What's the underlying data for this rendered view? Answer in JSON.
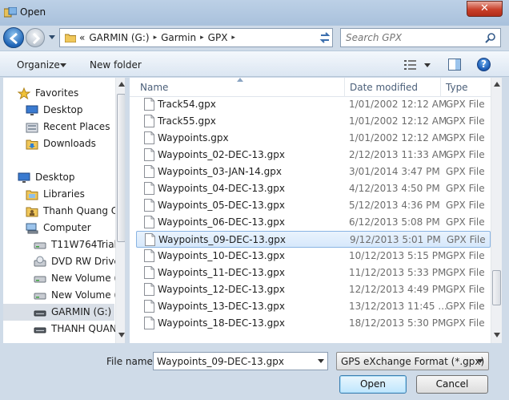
{
  "window": {
    "title": "Open",
    "close_glyph": "✕"
  },
  "address": {
    "prefix": "«",
    "crumbs": [
      "GARMIN (G:)",
      "Garmin",
      "GPX"
    ],
    "separator": "▸"
  },
  "search": {
    "placeholder": "Search GPX"
  },
  "toolbar": {
    "organize": "Organize",
    "new_folder": "New folder",
    "help_glyph": "?"
  },
  "nav": {
    "items": [
      {
        "label": "Favorites",
        "icon": "star-icon",
        "indent": 1
      },
      {
        "label": "Desktop",
        "icon": "desktop-icon",
        "indent": 2
      },
      {
        "label": "Recent Places",
        "icon": "recent-places-icon",
        "indent": 2
      },
      {
        "label": "Downloads",
        "icon": "downloads-icon",
        "indent": 2
      },
      {
        "label": "Desktop",
        "icon": "desktop-icon",
        "indent": 1
      },
      {
        "label": "Libraries",
        "icon": "libraries-icon",
        "indent": 2
      },
      {
        "label": "Thanh Quang C",
        "icon": "user-folder-icon",
        "indent": 2
      },
      {
        "label": "Computer",
        "icon": "computer-icon",
        "indent": 2
      },
      {
        "label": "T11W764Trial",
        "icon": "drive-icon",
        "indent": 3
      },
      {
        "label": "DVD RW Drive",
        "icon": "dvd-drive-icon",
        "indent": 3
      },
      {
        "label": "New Volume (",
        "icon": "drive-icon",
        "indent": 3
      },
      {
        "label": "New Volume (",
        "icon": "drive-icon",
        "indent": 3
      },
      {
        "label": "GARMIN (G:)",
        "icon": "removable-drive-icon",
        "indent": 3,
        "selected": true
      },
      {
        "label": "THANH QUAN",
        "icon": "removable-drive-icon",
        "indent": 3
      }
    ]
  },
  "columns": {
    "name": "Name",
    "date": "Date modified",
    "type": "Type"
  },
  "files": [
    {
      "name": "Track54.gpx",
      "date": "1/01/2002 12:12 AM",
      "type": "GPX File"
    },
    {
      "name": "Track55.gpx",
      "date": "1/01/2002 12:12 AM",
      "type": "GPX File"
    },
    {
      "name": "Waypoints.gpx",
      "date": "1/01/2002 12:12 AM",
      "type": "GPX File"
    },
    {
      "name": "Waypoints_02-DEC-13.gpx",
      "date": "2/12/2013 11:33 AM",
      "type": "GPX File"
    },
    {
      "name": "Waypoints_03-JAN-14.gpx",
      "date": "3/01/2014 3:47 PM",
      "type": "GPX File"
    },
    {
      "name": "Waypoints_04-DEC-13.gpx",
      "date": "4/12/2013 4:50 PM",
      "type": "GPX File"
    },
    {
      "name": "Waypoints_05-DEC-13.gpx",
      "date": "5/12/2013 4:36 PM",
      "type": "GPX File"
    },
    {
      "name": "Waypoints_06-DEC-13.gpx",
      "date": "6/12/2013 5:08 PM",
      "type": "GPX File"
    },
    {
      "name": "Waypoints_09-DEC-13.gpx",
      "date": "9/12/2013 5:01 PM",
      "type": "GPX File",
      "selected": true
    },
    {
      "name": "Waypoints_10-DEC-13.gpx",
      "date": "10/12/2013 5:15 PM",
      "type": "GPX File"
    },
    {
      "name": "Waypoints_11-DEC-13.gpx",
      "date": "11/12/2013 5:33 PM",
      "type": "GPX File"
    },
    {
      "name": "Waypoints_12-DEC-13.gpx",
      "date": "12/12/2013 4:49 PM",
      "type": "GPX File"
    },
    {
      "name": "Waypoints_13-DEC-13.gpx",
      "date": "13/12/2013 11:45 ...",
      "type": "GPX File"
    },
    {
      "name": "Waypoints_18-DEC-13.gpx",
      "date": "18/12/2013 5:30 PM",
      "type": "GPX File"
    }
  ],
  "bottom": {
    "file_name_label": "File name:",
    "file_name_value": "Waypoints_09-DEC-13.gpx",
    "file_type": "GPS eXchange Format (*.gpx)",
    "open": "Open",
    "cancel": "Cancel"
  },
  "colors": {
    "accent": "#1f64b6",
    "selection": "#d6e8fb",
    "selection_border": "#89b4e3"
  }
}
